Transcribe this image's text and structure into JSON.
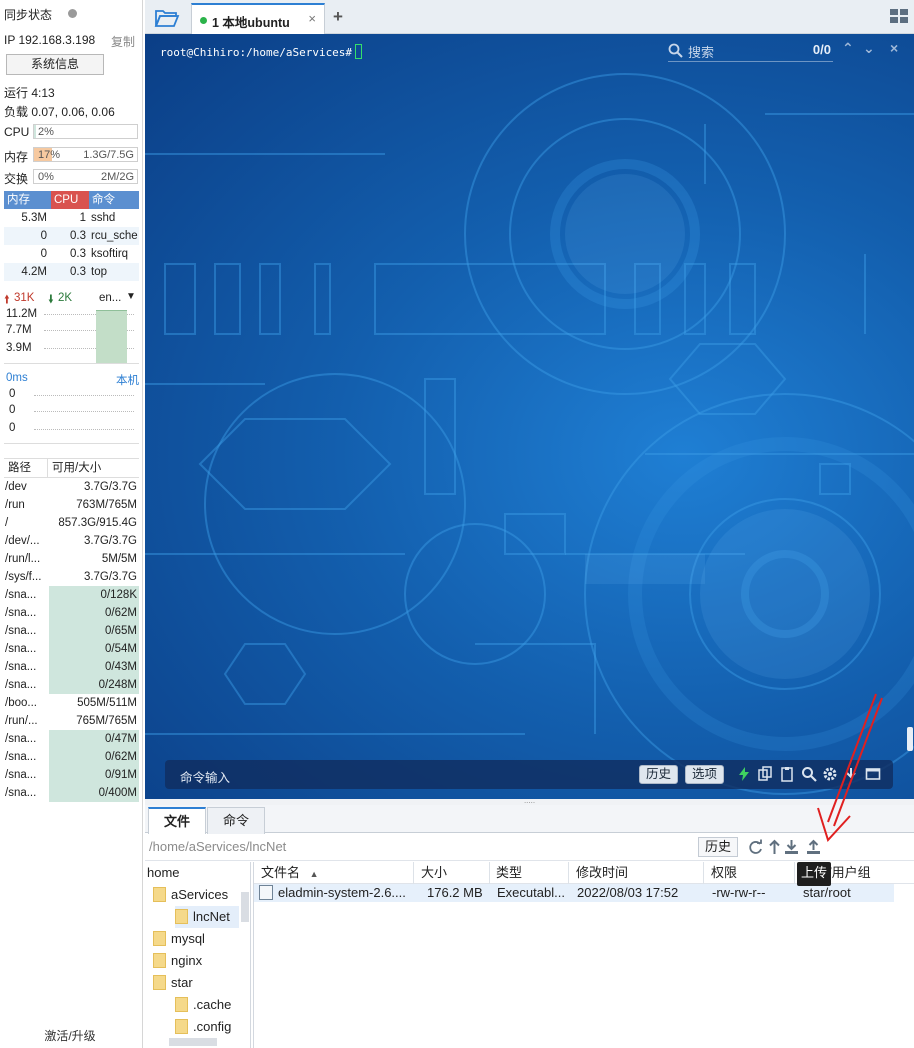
{
  "sidebar": {
    "sync_status": "同步状态",
    "ip": "IP 192.168.3.198",
    "copy": "复制",
    "sys_info": "系统信息",
    "uptime": "运行 4:13",
    "load": "负载 0.07, 0.06, 0.06",
    "cpu": {
      "label": "CPU",
      "value": "2%",
      "fraction": 0.02
    },
    "mem": {
      "label": "内存",
      "value": "17%",
      "detail": "1.3G/7.5G",
      "fraction": 0.17
    },
    "swap": {
      "label": "交换",
      "value": "0%",
      "detail": "2M/2G",
      "fraction": 0
    },
    "proc_headers": [
      "内存",
      "CPU",
      "命令"
    ],
    "processes": [
      {
        "mem": "5.3M",
        "cpu": "1",
        "cmd": "sshd"
      },
      {
        "mem": "0",
        "cpu": "0.3",
        "cmd": "rcu_sche"
      },
      {
        "mem": "0",
        "cpu": "0.3",
        "cmd": "ksoftirq"
      },
      {
        "mem": "4.2M",
        "cpu": "0.3",
        "cmd": "top"
      }
    ],
    "net": {
      "up": "31K",
      "down": "2K",
      "iface": "en...",
      "ticks": [
        "11.2M",
        "7.7M",
        "3.9M"
      ]
    },
    "ping": {
      "ms": "0ms",
      "host": "本机",
      "values": [
        "0",
        "0",
        "0"
      ]
    },
    "disk_headers": [
      "路径",
      "可用/大小"
    ],
    "disks": [
      {
        "path": "/dev",
        "size": "3.7G/3.7G",
        "bar": false
      },
      {
        "path": "/run",
        "size": "763M/765M",
        "bar": false
      },
      {
        "path": "/",
        "size": "857.3G/915.4G",
        "bar": false
      },
      {
        "path": "/dev/...",
        "size": "3.7G/3.7G",
        "bar": false
      },
      {
        "path": "/run/l...",
        "size": "5M/5M",
        "bar": false
      },
      {
        "path": "/sys/f...",
        "size": "3.7G/3.7G",
        "bar": false
      },
      {
        "path": "/sna...",
        "size": "0/128K",
        "bar": true
      },
      {
        "path": "/sna...",
        "size": "0/62M",
        "bar": true
      },
      {
        "path": "/sna...",
        "size": "0/65M",
        "bar": true
      },
      {
        "path": "/sna...",
        "size": "0/54M",
        "bar": true
      },
      {
        "path": "/sna...",
        "size": "0/43M",
        "bar": true
      },
      {
        "path": "/sna...",
        "size": "0/248M",
        "bar": true
      },
      {
        "path": "/boo...",
        "size": "505M/511M",
        "bar": false
      },
      {
        "path": "/run/...",
        "size": "765M/765M",
        "bar": false
      },
      {
        "path": "/sna...",
        "size": "0/47M",
        "bar": true
      },
      {
        "path": "/sna...",
        "size": "0/62M",
        "bar": true
      },
      {
        "path": "/sna...",
        "size": "0/91M",
        "bar": true
      },
      {
        "path": "/sna...",
        "size": "0/400M",
        "bar": true
      }
    ],
    "activate": "激活/升级"
  },
  "tabs": {
    "active_label": "1 本地ubuntu",
    "close": "×",
    "add": "+"
  },
  "terminal": {
    "prompt": "root@Chihiro:/home/aServices#",
    "search_placeholder": "搜索",
    "match_count": "0/0",
    "cmd_placeholder": "命令输入",
    "history_btn": "历史",
    "options_btn": "选项"
  },
  "bottom": {
    "tab_files": "文件",
    "tab_commands": "命令",
    "path": "/home/aServices/lncNet",
    "history_btn": "历史",
    "upload_tooltip": "上传",
    "tree": [
      {
        "name": "home",
        "level": 0,
        "folder": false,
        "selected": false
      },
      {
        "name": "aServices",
        "level": 1,
        "folder": true,
        "selected": false
      },
      {
        "name": "lncNet",
        "level": 2,
        "folder": true,
        "selected": true
      },
      {
        "name": "mysql",
        "level": 1,
        "folder": true,
        "selected": false
      },
      {
        "name": "nginx",
        "level": 1,
        "folder": true,
        "selected": false
      },
      {
        "name": "star",
        "level": 1,
        "folder": true,
        "selected": false
      },
      {
        "name": ".cache",
        "level": 2,
        "folder": true,
        "selected": false
      },
      {
        "name": ".config",
        "level": 2,
        "folder": true,
        "selected": false
      }
    ],
    "columns": [
      "文件名",
      "大小",
      "类型",
      "修改时间",
      "权限",
      "用户/用户组"
    ],
    "files": [
      {
        "name": "eladmin-system-2.6....",
        "size": "176.2 MB",
        "type": "Executabl...",
        "mtime": "2022/08/03 17:52",
        "perm": "-rw-rw-r--",
        "owner": "star/root"
      }
    ]
  },
  "colors": {
    "accent": "#2d7fd3",
    "terminal_bg": "#135fae",
    "mem_fill": "#f6c9a0",
    "disk_bar": "#cfe6dd",
    "arrow": "#e02020"
  }
}
